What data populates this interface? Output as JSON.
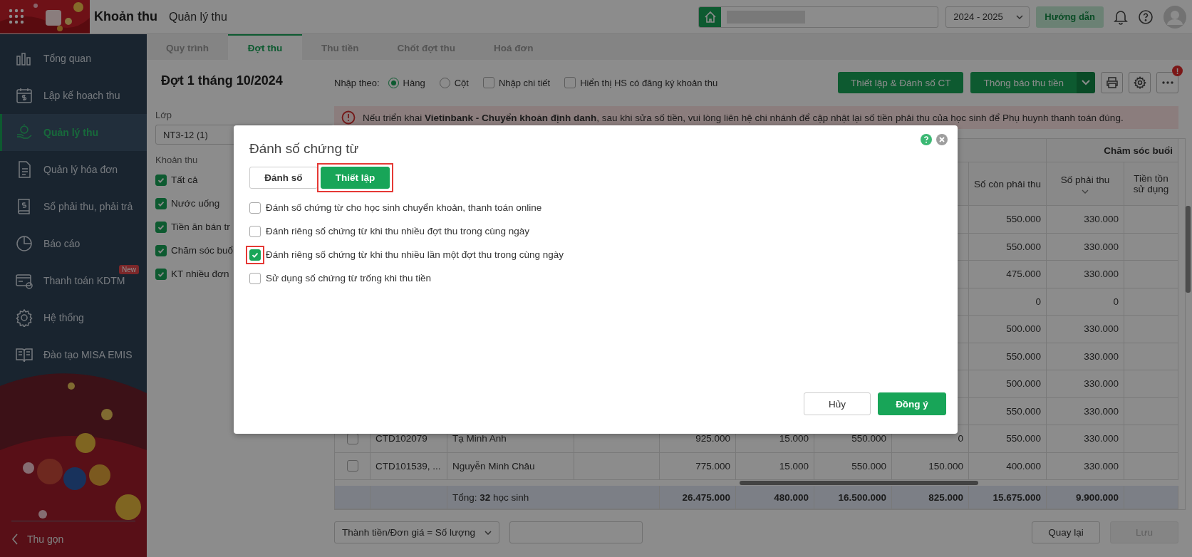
{
  "app": {
    "module_title": "Khoản thu",
    "page_title": "Quản lý thu",
    "school_year": "2024 - 2025",
    "guide_button": "Hướng dẫn"
  },
  "sidebar": {
    "items": [
      {
        "label": "Tổng quan",
        "kind": "chart",
        "selected": false
      },
      {
        "label": "Lập kế hoạch thu",
        "kind": "calendar",
        "selected": false
      },
      {
        "label": "Quản lý thu",
        "kind": "coin",
        "selected": true
      },
      {
        "label": "Quản lý hóa đơn",
        "kind": "document",
        "selected": false
      },
      {
        "label": "Sổ phải thu, phải trả",
        "kind": "book",
        "selected": false
      },
      {
        "label": "Báo cáo",
        "kind": "pie",
        "selected": false
      },
      {
        "label": "Thanh toán KDTM",
        "kind": "card",
        "selected": false,
        "badge": "New"
      },
      {
        "label": "Hệ thống",
        "kind": "gear",
        "selected": false
      },
      {
        "label": "Đào tạo MISA EMIS",
        "kind": "openbook",
        "selected": false
      }
    ],
    "collapse": "Thu gọn"
  },
  "tabs": [
    {
      "label": "Quy trình",
      "selected": false
    },
    {
      "label": "Đợt thu",
      "selected": true
    },
    {
      "label": "Thu tiền",
      "selected": false
    },
    {
      "label": "Chốt đợt thu",
      "selected": false
    },
    {
      "label": "Hoá đơn",
      "selected": false
    }
  ],
  "batch_title": "Đợt 1 tháng 10/2024",
  "filters": {
    "class_label": "Lớp",
    "class_value": "NT3-12 (1)",
    "fees_label": "Khoản thu",
    "fees": [
      {
        "label": "Tất cả",
        "checked": true
      },
      {
        "label": "Nước uống",
        "checked": true
      },
      {
        "label": "Tiền ăn bán tr",
        "checked": true
      },
      {
        "label": "Chăm sóc buổ",
        "checked": true
      },
      {
        "label": "KT nhiều đơn",
        "checked": true
      }
    ]
  },
  "input_mode": {
    "label": "Nhập theo:",
    "options": [
      {
        "label": "Hàng",
        "selected": true
      },
      {
        "label": "Cột",
        "selected": false
      }
    ],
    "toggles": [
      {
        "label": "Nhập chi tiết",
        "checked": false
      },
      {
        "label": "Hiển thị HS có đăng ký khoản thu",
        "checked": false
      }
    ]
  },
  "actions": {
    "setup_button": "Thiết lập & Đánh số CT",
    "notify_button": "Thông báo thu tiền",
    "more_badge": "!"
  },
  "alert": "Nếu triển khai **Vietinbank - Chuyển khoản định danh**, sau khi sửa số tiền, vui lòng liên hệ chi nhánh để cập nhật lại số tiền phải thu của học sinh để Phụ huynh thanh toán đúng.",
  "table": {
    "group_header": "Chăm sóc buổi",
    "columns": [
      "Số còn phải thu",
      "Số phải thu",
      "Tiền tồn sử dụng"
    ],
    "rows": [
      {
        "so_con_phai_thu": "550.000",
        "so_phai_thu": "330.000"
      },
      {
        "so_con_phai_thu": "550.000",
        "so_phai_thu": "330.000"
      },
      {
        "so_con_phai_thu": "475.000",
        "so_phai_thu": "330.000"
      },
      {
        "so_con_phai_thu": "0",
        "so_phai_thu": "0"
      },
      {
        "so_con_phai_thu": "500.000",
        "so_phai_thu": "330.000"
      },
      {
        "so_con_phai_thu": "550.000",
        "so_phai_thu": "330.000"
      },
      {
        "so_con_phai_thu": "500.000",
        "so_phai_thu": "330.000"
      },
      {
        "so_con_phai_thu": "550.000",
        "so_phai_thu": "330.000"
      },
      {
        "checked": false,
        "code": "CTD102079",
        "name": "Tạ Minh Anh",
        "column_5": "925.000",
        "column_6": "15.000",
        "column_7": "550.000",
        "column_8": "0",
        "so_con_phai_thu": "550.000",
        "so_phai_thu": "330.000"
      },
      {
        "checked": false,
        "code": "CTD101539, ...",
        "name": "Nguyễn Minh Châu",
        "column_5": "775.000",
        "column_6": "15.000",
        "column_7": "550.000",
        "column_8": "150.000",
        "so_con_phai_thu": "400.000",
        "so_phai_thu": "330.000"
      }
    ],
    "total": {
      "label": "Tổng: **32** học sinh",
      "values": [
        "26.475.000",
        "480.000",
        "16.500.000",
        "825.000",
        "15.675.000",
        "9.900.000"
      ]
    }
  },
  "footer": {
    "formula": "Thành tiền/Đơn giá = Số lượng",
    "back_button": "Quay lại",
    "save_button": "Lưu",
    "save_disabled": true
  },
  "dialog": {
    "title": "Đánh số chứng từ",
    "modes": [
      {
        "label": "Đánh số",
        "selected": false,
        "annotated": false
      },
      {
        "label": "Thiết lập",
        "selected": true,
        "annotated": true
      }
    ],
    "options": [
      {
        "label": "Đánh số chứng từ cho học sinh chuyển khoản, thanh toán online",
        "checked": false,
        "annotated": false
      },
      {
        "label": "Đánh riêng số chứng từ khi thu nhiều đợt thu trong cùng ngày",
        "checked": false,
        "annotated": false
      },
      {
        "label": "Đánh riêng số chứng từ khi thu nhiều lần một đợt thu trong cùng ngày",
        "checked": true,
        "annotated": true
      },
      {
        "label": "Sử dụng số chứng từ trống khi thu tiền",
        "checked": false,
        "annotated": false
      }
    ],
    "cancel": "Hủy",
    "confirm": "Đồng ý"
  }
}
